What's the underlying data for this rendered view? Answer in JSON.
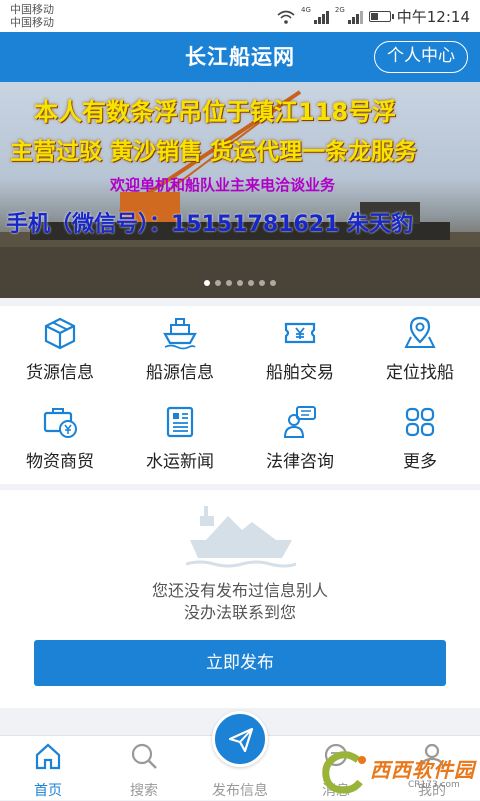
{
  "status_bar": {
    "carrier1": "中国移动",
    "carrier2": "中国移动",
    "time": "中午12:14",
    "net_tag1": "4G",
    "net_tag2": "2G",
    "battery_level": 0.4
  },
  "header": {
    "title": "长江船运网",
    "profile_label": "个人中心",
    "bg_color": "#1b82d6"
  },
  "banner": {
    "line1": "本人有数条浮吊位于镇江118号浮",
    "line2": "主营过驳  黄沙销售  货运代理一条龙服务",
    "line3": "欢迎单机和船队业主来电洽谈业务",
    "line4": "手机（微信号）：15151781621    朱天豹",
    "slide_count": 7,
    "active_slide": 0
  },
  "menu": [
    {
      "label": "货源信息",
      "icon": "cargo-box-icon"
    },
    {
      "label": "船源信息",
      "icon": "ship-icon"
    },
    {
      "label": "船舶交易",
      "icon": "trade-ticket-icon"
    },
    {
      "label": "定位找船",
      "icon": "map-location-icon"
    },
    {
      "label": "物资商贸",
      "icon": "briefcase-yen-icon"
    },
    {
      "label": "水运新闻",
      "icon": "news-icon"
    },
    {
      "label": "法律咨询",
      "icon": "consultant-icon"
    },
    {
      "label": "更多",
      "icon": "grid-more-icon"
    }
  ],
  "empty_state": {
    "line1": "您还没有发布过信息别人",
    "line2": "没办法联系到您",
    "button": "立即发布"
  },
  "bottom_nav": [
    {
      "label": "首页",
      "icon": "home-icon",
      "active": true
    },
    {
      "label": "搜索",
      "icon": "search-icon",
      "active": false
    },
    {
      "label": "发布信息",
      "icon": "send-icon",
      "active": false
    },
    {
      "label": "消息",
      "icon": "message-icon",
      "active": false
    },
    {
      "label": "我的",
      "icon": "user-icon",
      "active": false
    }
  ],
  "watermark": {
    "text": "西西软件园",
    "sub": "CR173.com"
  }
}
